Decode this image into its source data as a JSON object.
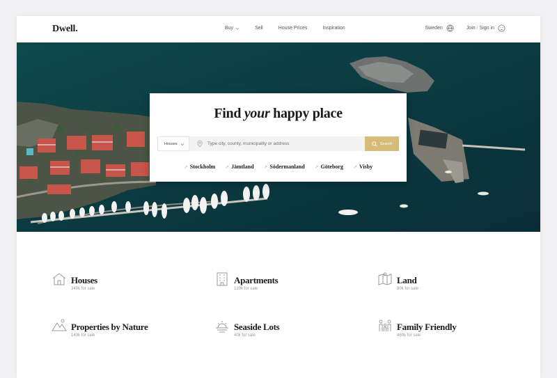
{
  "header": {
    "logo": "Dwell.",
    "nav": [
      {
        "label": "Buy"
      },
      {
        "label": "Sell"
      },
      {
        "label": "House Prices"
      },
      {
        "label": "Inspiration"
      }
    ],
    "country": "Sweden",
    "join": "Join",
    "signin": "Sign in"
  },
  "hero": {
    "headline_pre": "Find",
    "headline_em": "your",
    "headline_post": "happy place",
    "type_select": "Houses",
    "search_placeholder": "Type city, county, municipality or address",
    "search_button": "Search",
    "places": [
      "Stockholm",
      "Jämtland",
      "Södermanland",
      "Göteborg",
      "Visby"
    ]
  },
  "categories": [
    {
      "title": "Houses",
      "sub": "340k for sale",
      "icon": "house-icon"
    },
    {
      "title": "Apartments",
      "sub": "120k for sale",
      "icon": "building-icon"
    },
    {
      "title": "Land",
      "sub": "80k for sale",
      "icon": "map-icon"
    },
    {
      "title": "Properties by Nature",
      "sub": "140k for sale",
      "icon": "mountain-icon"
    },
    {
      "title": "Seaside Lots",
      "sub": "40k for sale",
      "icon": "sunset-icon"
    },
    {
      "title": "Family Friendly",
      "sub": "460k for sale",
      "icon": "family-icon"
    }
  ],
  "colors": {
    "accent": "#d6bc7a",
    "sea": "#0d3a3f"
  }
}
